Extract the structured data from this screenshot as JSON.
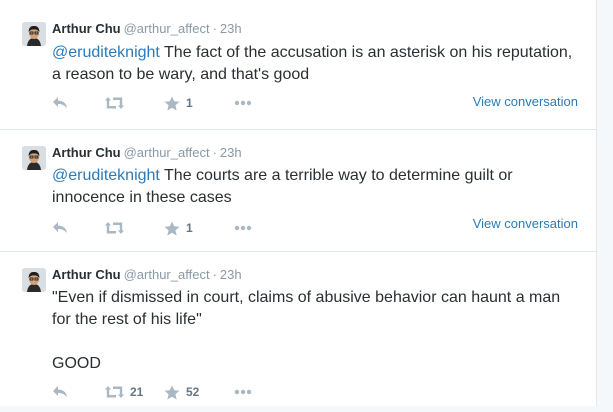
{
  "tweets": [
    {
      "fullname": "Arthur Chu",
      "username": "@arthur_affect",
      "separator": "·",
      "time": "23h",
      "mention": "@eruditeknight",
      "body": " The fact of the accusation is an asterisk on his reputation, a reason to be wary, and that's good",
      "retweet_count": "",
      "favorite_count": "1",
      "view_conversation": "View conversation"
    },
    {
      "fullname": "Arthur Chu",
      "username": "@arthur_affect",
      "separator": "·",
      "time": "23h",
      "mention": "@eruditeknight",
      "body": " The courts are a terrible way to determine guilt or innocence in these cases",
      "retweet_count": "",
      "favorite_count": "1",
      "view_conversation": "View conversation"
    },
    {
      "fullname": "Arthur Chu",
      "username": "@arthur_affect",
      "separator": "·",
      "time": "23h",
      "body_line1": "\"Even if dismissed in court, claims of abusive behavior can haunt a man for the rest of his life\"",
      "body_line2": "GOOD",
      "retweet_count": "21",
      "favorite_count": "52"
    }
  ],
  "icons": {
    "reply": "reply-icon",
    "retweet": "retweet-icon",
    "favorite": "star-icon",
    "more": "more-dots-icon"
  },
  "colors": {
    "link": "#2b7bb9",
    "muted": "#8899a6",
    "icon": "#aab8c2",
    "text": "#292f33"
  }
}
